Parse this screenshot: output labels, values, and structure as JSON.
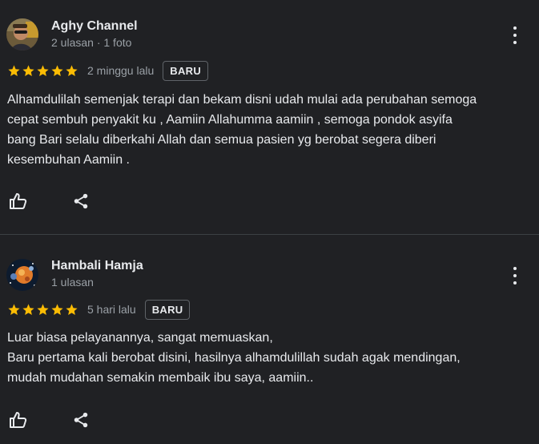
{
  "colors": {
    "background": "#202124",
    "text_primary": "#e8eaed",
    "text_secondary": "#9aa0a6",
    "star": "#fbbc04",
    "divider": "#3c4043"
  },
  "reviews": [
    {
      "reviewer_name": "Aghy Channel",
      "reviewer_meta": "2 ulasan · 1 foto",
      "rating": 5,
      "date": "2 minggu lalu",
      "badge": "BARU",
      "text_lines": [
        "Alhamdulilah semenjak terapi dan bekam disni udah mulai ada perubahan semoga",
        "cepat sembuh penyakit ku , Aamiin Allahumma aamiin , semoga pondok asyifa",
        "bang Bari selalu diberkahi Allah dan semua pasien yg berobat segera diberi",
        "kesembuhan Aamiin ."
      ],
      "icons": {
        "avatar": "profile-photo",
        "more": "more-vert-icon",
        "like": "thumbs-up-icon",
        "share": "share-icon"
      }
    },
    {
      "reviewer_name": "Hambali Hamja",
      "reviewer_meta": "1 ulasan",
      "rating": 5,
      "date": "5 hari lalu",
      "badge": "BARU",
      "text_lines": [
        "Luar biasa pelayanannya, sangat memuaskan,",
        "Baru pertama kali berobat disini, hasilnya alhamdulillah sudah agak mendingan,",
        "mudah mudahan semakin membaik ibu saya, aamiin.."
      ],
      "icons": {
        "avatar": "profile-photo",
        "more": "more-vert-icon",
        "like": "thumbs-up-icon",
        "share": "share-icon"
      }
    }
  ]
}
